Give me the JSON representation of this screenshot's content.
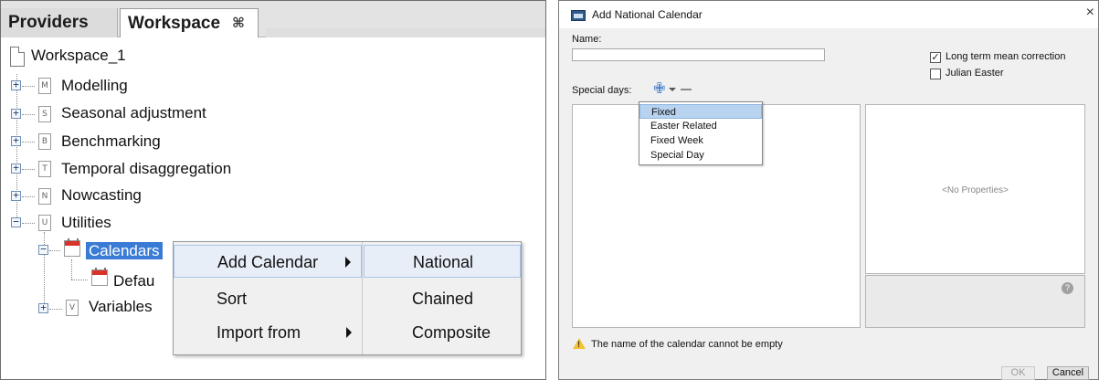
{
  "explorer": {
    "tabs": [
      {
        "label": "Providers"
      },
      {
        "label": "Workspace"
      }
    ],
    "workspace_tab_close": "⌘",
    "root": "Workspace_1",
    "nodes": [
      {
        "label": "Modelling",
        "icon_letter": "M"
      },
      {
        "label": "Seasonal adjustment",
        "icon_letter": "S"
      },
      {
        "label": "Benchmarking",
        "icon_letter": "B"
      },
      {
        "label": "Temporal disaggregation",
        "icon_letter": "T"
      },
      {
        "label": "Nowcasting",
        "icon_letter": "N"
      },
      {
        "label": "Utilities",
        "icon_letter": "U"
      }
    ],
    "calendars_label": "Calendars",
    "default_label": "Defau",
    "variables_label": "Variables",
    "variables_icon_letter": "V",
    "expand_plus": "+",
    "collapse_minus": "−"
  },
  "context_menu": {
    "items": [
      {
        "label": "Add Calendar"
      },
      {
        "label": "Sort"
      },
      {
        "label": "Import from"
      }
    ],
    "submenu": [
      {
        "label": "National"
      },
      {
        "label": "Chained"
      },
      {
        "label": "Composite"
      }
    ]
  },
  "dialog": {
    "title": "Add National Calendar",
    "close_glyph": "×",
    "name_label": "Name:",
    "name_value": "",
    "long_term_mean_correction_label": "Long term mean correction",
    "long_term_mean_correction_checked": true,
    "julian_easter_label": "Julian Easter",
    "julian_easter_checked": false,
    "check_glyph": "✓",
    "special_days_label": "Special days:",
    "add_glyph": "✙",
    "special_day_options": [
      {
        "label": "Fixed"
      },
      {
        "label": "Easter Related"
      },
      {
        "label": "Fixed Week"
      },
      {
        "label": "Special Day"
      }
    ],
    "no_properties": "<No Properties>",
    "help_glyph": "?",
    "warning_glyph": "!",
    "warning": "The name of the calendar cannot be empty",
    "ok_label": "OK",
    "cancel_label": "Cancel"
  }
}
